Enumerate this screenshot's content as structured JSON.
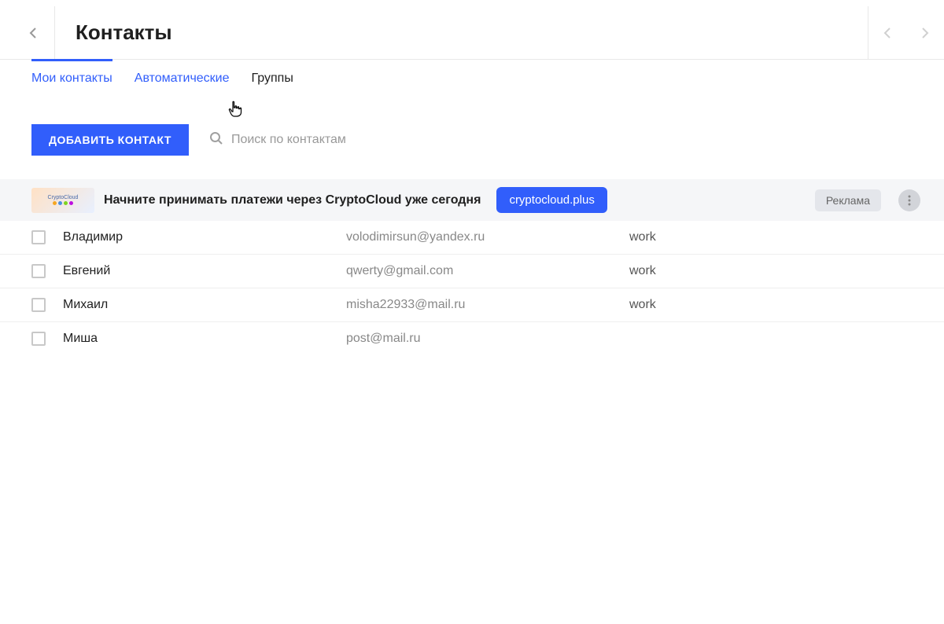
{
  "header": {
    "title": "Контакты"
  },
  "tabs": [
    {
      "label": "Мои контакты",
      "state": "active"
    },
    {
      "label": "Автоматические",
      "state": "link"
    },
    {
      "label": "Группы",
      "state": "plain"
    }
  ],
  "toolbar": {
    "add_label": "ДОБАВИТЬ КОНТАКТ",
    "search_placeholder": "Поиск по контактам"
  },
  "ad": {
    "image_text": "CryptoCloud",
    "text": "Начните принимать платежи через CryptoCloud уже сегодня",
    "cta": "cryptocloud.plus",
    "label": "Реклама"
  },
  "contacts": [
    {
      "name": "Владимир",
      "email": "volodimirsun@yandex.ru",
      "group": "work"
    },
    {
      "name": "Евгений",
      "email": "qwerty@gmail.com",
      "group": "work"
    },
    {
      "name": "Михаил",
      "email": "misha22933@mail.ru",
      "group": "work"
    },
    {
      "name": "Миша",
      "email": "post@mail.ru",
      "group": ""
    }
  ]
}
